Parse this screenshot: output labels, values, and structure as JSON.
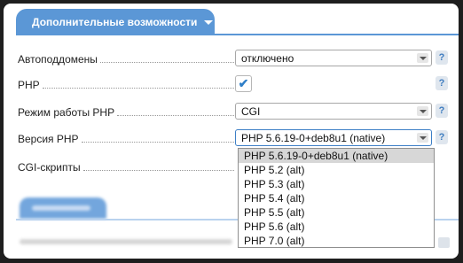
{
  "section_tab": {
    "label": "Дополнительные возможности"
  },
  "fields": {
    "subdomains": {
      "label": "Автоподдомены",
      "value": "отключено",
      "help": "?"
    },
    "php": {
      "label": "PHP",
      "checked": true,
      "check_glyph": "✔",
      "help": "?"
    },
    "php_mode": {
      "label": "Режим работы PHP",
      "value": "CGI",
      "help": "?"
    },
    "php_version": {
      "label": "Версия PHP",
      "value": "PHP 5.6.19-0+deb8u1 (native)",
      "help": "?"
    },
    "cgi_scripts": {
      "label": "CGI-скрипты"
    }
  },
  "php_version_options": [
    "PHP 5.6.19-0+deb8u1 (native)",
    "PHP 5.2 (alt)",
    "PHP 5.3 (alt)",
    "PHP 5.4 (alt)",
    "PHP 5.5 (alt)",
    "PHP 5.6 (alt)",
    "PHP 7.0 (alt)"
  ],
  "colors": {
    "accent": "#5b97d6",
    "selected_option_bg": "#d7d7d7"
  }
}
